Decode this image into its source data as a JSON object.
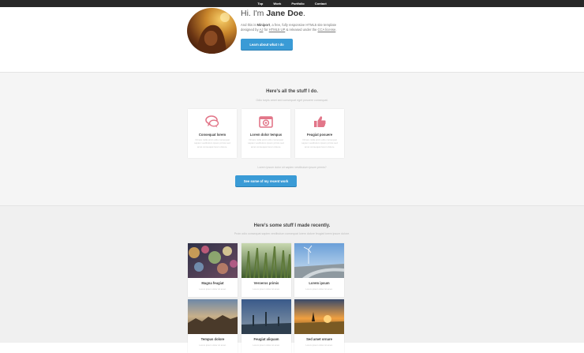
{
  "nav": {
    "items": [
      "Top",
      "Work",
      "Portfolio",
      "Contact"
    ]
  },
  "intro": {
    "greeting": "Hi. I'm",
    "name": "Jane Doe",
    "period": ".",
    "body_1": "And this is",
    "site_name": "Miniport",
    "body_2": ", a free, fully responsive HTML5 site template designed by",
    "author": "AJ",
    "body_3": "for",
    "html5up": "HTML5 UP",
    "body_4": "& released under the",
    "license": "CCA license",
    "body_5": ".",
    "button": "Learn about what I do"
  },
  "work": {
    "title": "Here's all the stuff I do.",
    "subtitle": "Odio turpis amet sed consequat eget posuere consequat.",
    "features": [
      {
        "icon": "comments-icon",
        "title": "Consequat lorem",
        "desc": "Ornare nulla proin odio consequat sapien vestibulum ipsum primis sed amet consequat lorem dolore."
      },
      {
        "icon": "camera-icon",
        "title": "Lorem dolor tempus",
        "desc": "Ornare nulla proin odio consequat sapien vestibulum ipsum primis sed amet consequat lorem dolore."
      },
      {
        "icon": "thumbs-up-icon",
        "title": "Feugiat posuere",
        "desc": "Ornare nulla proin odio consequat sapien vestibulum ipsum primis sed amet consequat lorem dolore."
      }
    ],
    "note": "Lorem ipsum dolor sit sapien vestibulum ipsum primis?",
    "button": "See some of my recent work"
  },
  "portfolio": {
    "title": "Here's some stuff I made recently.",
    "subtitle": "Proin odio consequat sapien vestibulum consequat lorem dolore feugiat lorem ipsum dolore.",
    "items": [
      {
        "title": "Magna feugiat",
        "desc": "Lorem ipsum dolor sit amet."
      },
      {
        "title": "Veroeros primis",
        "desc": "Lorem ipsum dolor sit amet."
      },
      {
        "title": "Lorem ipsum",
        "desc": "Lorem ipsum dolor sit amet."
      },
      {
        "title": "Tempus dolore",
        "desc": "Lorem ipsum dolor sit amet."
      },
      {
        "title": "Feugiat aliquam",
        "desc": "Lorem ipsum dolor sit amet."
      },
      {
        "title": "Sed amet ornare",
        "desc": "Lorem ipsum dolor sit amet."
      }
    ]
  },
  "colors": {
    "nav_bg": "#282828",
    "accent": "#3a9bd6",
    "icon": "#e27689"
  }
}
